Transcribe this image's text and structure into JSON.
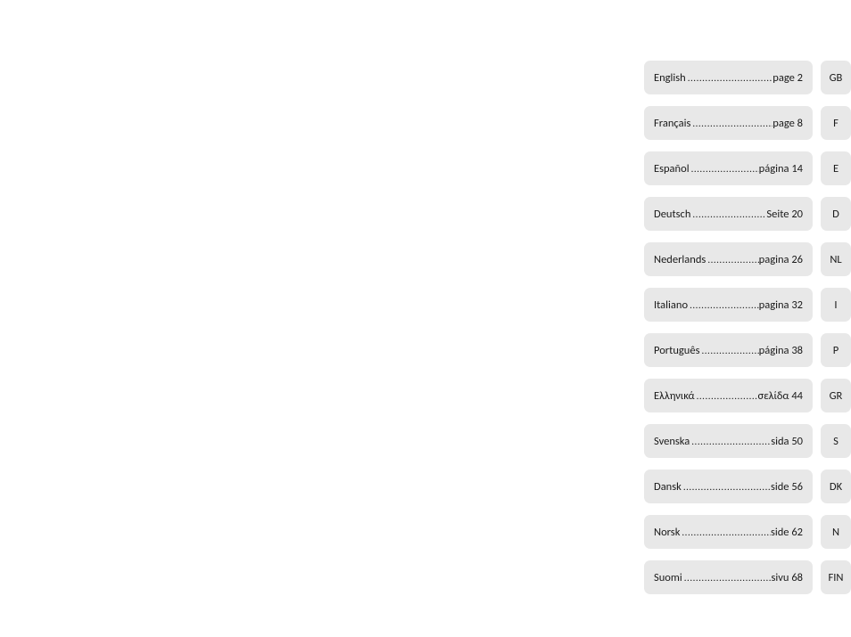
{
  "toc": [
    {
      "language": "English",
      "pageLabel": "page  2",
      "code": "GB"
    },
    {
      "language": "Français",
      "pageLabel": "page 8",
      "code": "F"
    },
    {
      "language": "Español",
      "pageLabel": "página 14",
      "code": "E"
    },
    {
      "language": "Deutsch",
      "pageLabel": "Seite 20",
      "code": "D"
    },
    {
      "language": "Nederlands",
      "pageLabel": "pagina 26",
      "code": "NL"
    },
    {
      "language": "Italiano",
      "pageLabel": "pagina 32",
      "code": "I"
    },
    {
      "language": "Português",
      "pageLabel": "página 38",
      "code": "P"
    },
    {
      "language": "Ελληνικά",
      "pageLabel": "σελίδα 44",
      "code": "GR"
    },
    {
      "language": "Svenska",
      "pageLabel": "sida 50",
      "code": "S"
    },
    {
      "language": "Dansk",
      "pageLabel": "side 56",
      "code": "DK"
    },
    {
      "language": "Norsk",
      "pageLabel": "side 62",
      "code": "N"
    },
    {
      "language": "Suomi",
      "pageLabel": "sivu 68",
      "code": "FIN"
    }
  ]
}
